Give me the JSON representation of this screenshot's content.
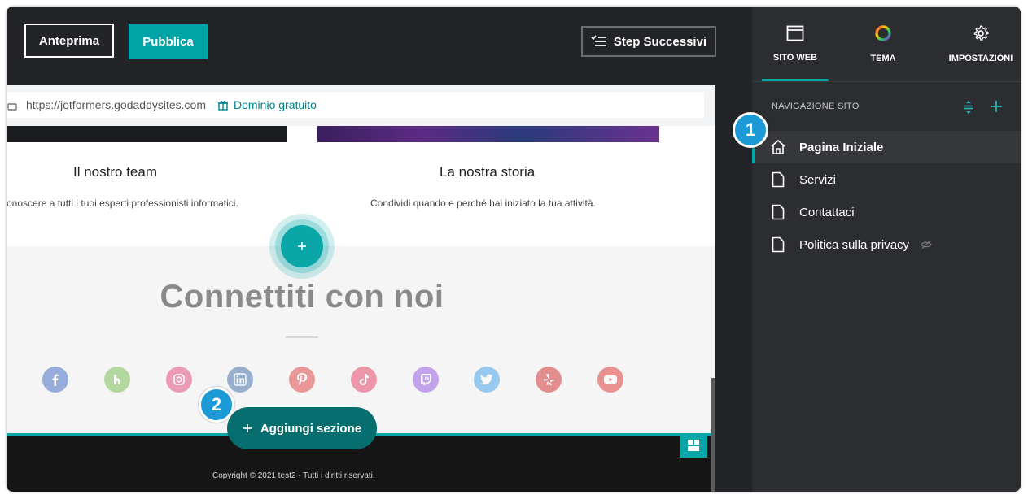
{
  "toolbar": {
    "preview_label": "Anteprima",
    "publish_label": "Pubblica",
    "next_steps_label": "Step Successivi"
  },
  "browser": {
    "url": "https://jotformers.godaddysites.com",
    "domain_link": "Dominio gratuito"
  },
  "cards": [
    {
      "title": "Il nostro team",
      "description": "onoscere a tutti i tuoi esperti professionisti informatici."
    },
    {
      "title": "La nostra storia",
      "description": "Condividi quando e perché hai iniziato la tua attività."
    }
  ],
  "connect": {
    "title": "Connettiti con noi",
    "social_icons": [
      "facebook-icon",
      "houzz-icon",
      "instagram-icon",
      "linkedin-icon",
      "pinterest-icon",
      "tiktok-icon",
      "twitch-icon",
      "twitter-icon",
      "yelp-icon",
      "youtube-icon"
    ]
  },
  "footer": {
    "copyright": "Copyright © 2021 test2 - Tutti i diritti riservati."
  },
  "add_section_label": "Aggiungi sezione",
  "callouts": {
    "first": "1",
    "second": "2"
  },
  "panel": {
    "tabs": [
      {
        "label": "SITO WEB",
        "icon": "browser-window-icon"
      },
      {
        "label": "TEMA",
        "icon": "color-wheel-icon"
      },
      {
        "label": "IMPOSTAZIONI",
        "icon": "gear-icon"
      }
    ],
    "nav_header": "NAVIGAZIONE SITO",
    "nav_items": [
      {
        "label": "Pagina Iniziale",
        "icon": "home-icon",
        "active": true
      },
      {
        "label": "Servizi",
        "icon": "page-icon"
      },
      {
        "label": "Contattaci",
        "icon": "page-icon"
      },
      {
        "label": "Politica sulla privacy",
        "icon": "page-icon",
        "hidden": true
      }
    ]
  },
  "colors": {
    "accent": "#00a4a6",
    "panel_bg": "#2c2d30",
    "dark_bg": "#232427",
    "callout": "#1b9ad6"
  }
}
